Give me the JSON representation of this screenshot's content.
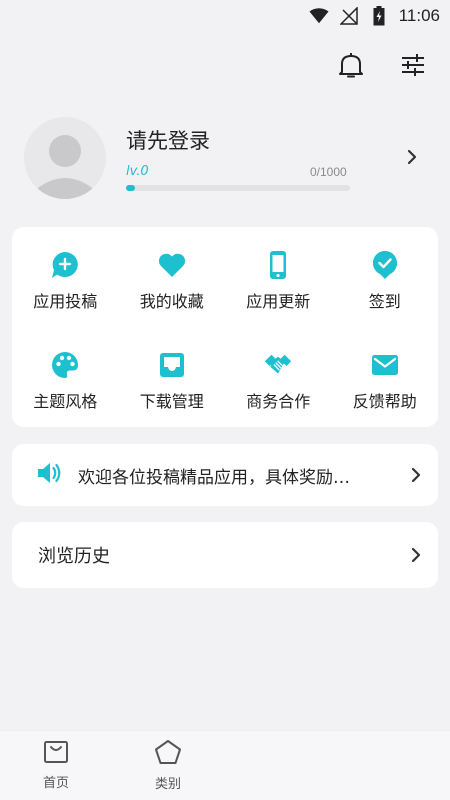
{
  "status_bar": {
    "time": "11:06"
  },
  "profile": {
    "name": "请先登录",
    "level": "lv.0",
    "exp": "0/1000",
    "progress": 0.04
  },
  "grid": [
    {
      "label": "应用投稿",
      "icon": "chat-plus-icon"
    },
    {
      "label": "我的收藏",
      "icon": "heart-icon"
    },
    {
      "label": "应用更新",
      "icon": "phone-icon"
    },
    {
      "label": "签到",
      "icon": "check-circle-icon"
    },
    {
      "label": "主题风格",
      "icon": "palette-icon"
    },
    {
      "label": "下载管理",
      "icon": "tray-icon"
    },
    {
      "label": "商务合作",
      "icon": "handshake-icon"
    },
    {
      "label": "反馈帮助",
      "icon": "mail-icon"
    }
  ],
  "notice": {
    "text": "欢迎各位投稿精品应用，具体奖励…",
    "icon": "speaker-icon"
  },
  "history": {
    "label": "浏览历史"
  },
  "bottom_nav": [
    {
      "label": "首页",
      "icon": "home-box-icon"
    },
    {
      "label": "类别",
      "icon": "pentagon-icon"
    }
  ],
  "colors": {
    "accent": "#1ebfcf",
    "background": "#f2f2f4",
    "card": "#ffffff"
  }
}
